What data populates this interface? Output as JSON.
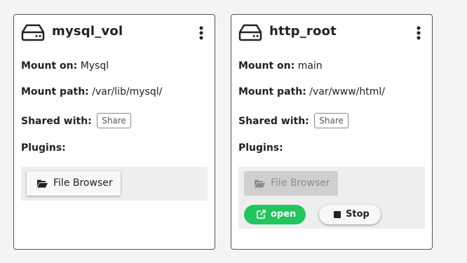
{
  "volumes": [
    {
      "title": "mysql_vol",
      "mount_on_label": "Mount on:",
      "mount_on_value": "Mysql",
      "mount_path_label": "Mount path:",
      "mount_path_value": "/var/lib/mysql/",
      "shared_with_label": "Shared with:",
      "share_button": "Share",
      "plugins_label": "Plugins:",
      "file_browser_label": "File Browser",
      "file_browser_state": "enabled"
    },
    {
      "title": "http_root",
      "mount_on_label": "Mount on:",
      "mount_on_value": "main",
      "mount_path_label": "Mount path:",
      "mount_path_value": "/var/www/html/",
      "shared_with_label": "Shared with:",
      "share_button": "Share",
      "plugins_label": "Plugins:",
      "file_browser_label": "File Browser",
      "file_browser_state": "disabled",
      "open_button": "open",
      "stop_button": "Stop"
    }
  ],
  "icons": {
    "drive": "hard-drive-icon",
    "menu": "vertical-ellipsis-icon",
    "folder": "folder-open-icon",
    "open": "external-link-icon",
    "stop": "stop-square-icon"
  },
  "colors": {
    "open_button": "#22c55e",
    "plugin_area": "#eeeeee",
    "card_border": "#555555"
  }
}
